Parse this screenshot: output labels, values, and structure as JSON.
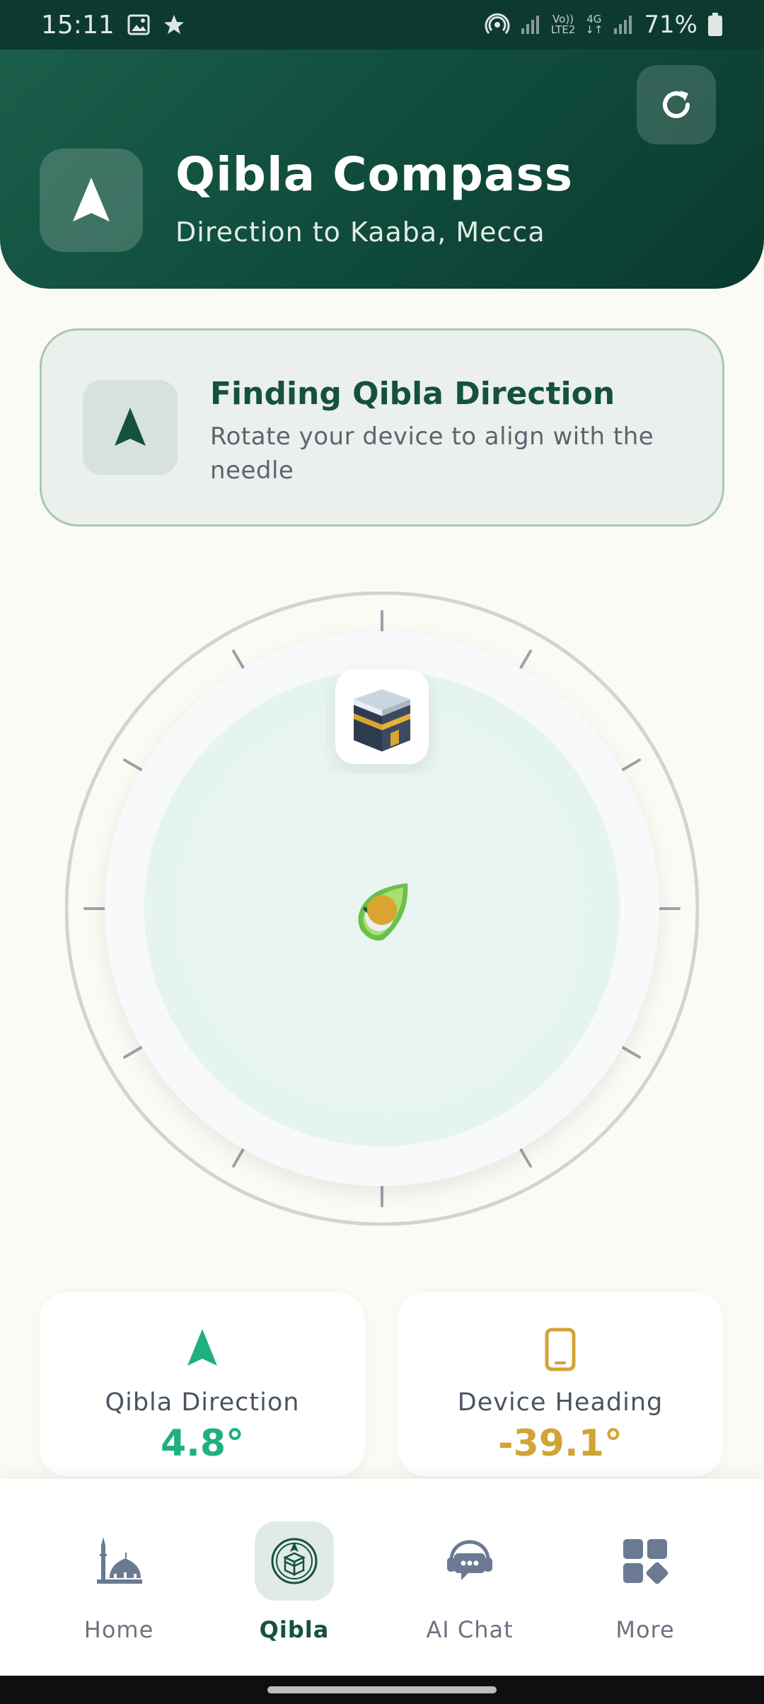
{
  "status_bar": {
    "time": "15:11",
    "network_label_top": "Vo))",
    "network_label_bottom": "LTE2",
    "network_type": "4G",
    "battery": "71%"
  },
  "header": {
    "title": "Qibla Compass",
    "subtitle": "Direction to Kaaba, Mecca"
  },
  "info_card": {
    "title": "Finding Qibla Direction",
    "text": "Rotate your device to align with the needle"
  },
  "compass": {
    "qibla_marker_icon": "kaaba-icon",
    "needle_icon": "compass-needle-icon"
  },
  "stats": {
    "qibla": {
      "label": "Qibla Direction",
      "value": "4.8°"
    },
    "heading": {
      "label": "Device Heading",
      "value": "-39.1°"
    }
  },
  "nav": {
    "items": [
      {
        "label": "Home",
        "icon": "mosque-icon",
        "active": false
      },
      {
        "label": "Qibla",
        "icon": "qibla-kaaba-icon",
        "active": true
      },
      {
        "label": "AI Chat",
        "icon": "chat-support-icon",
        "active": false
      },
      {
        "label": "More",
        "icon": "grid-icon",
        "active": false
      }
    ]
  },
  "colors": {
    "primary_dark": "#0f4a3a",
    "accent_green": "#1fb07f",
    "accent_gold": "#d2a436",
    "background": "#fafbf5"
  }
}
